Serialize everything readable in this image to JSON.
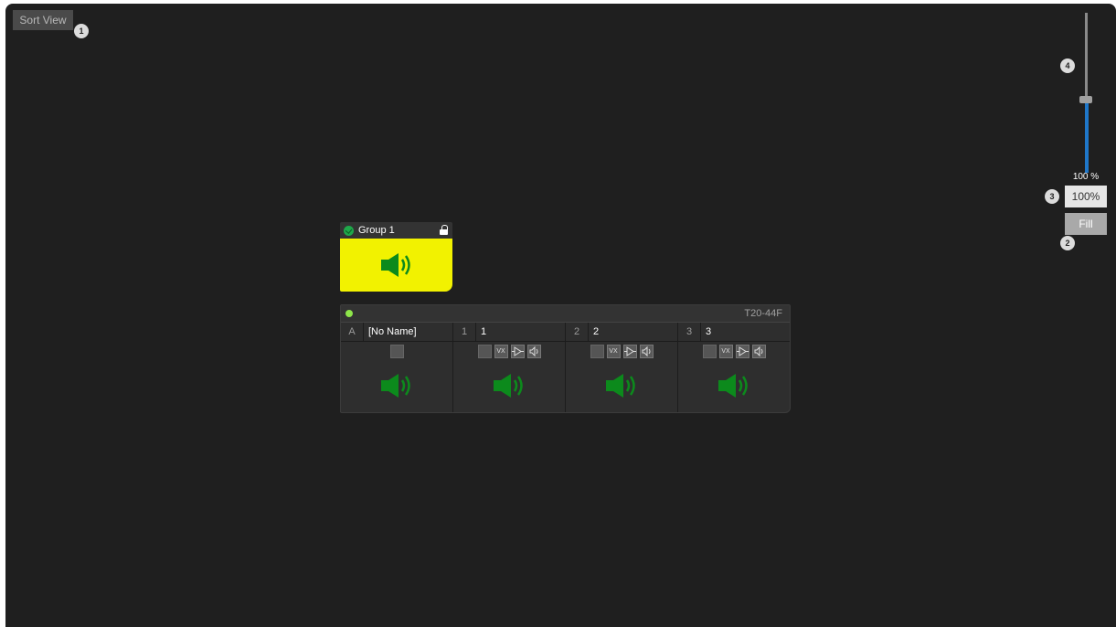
{
  "toolbar": {
    "sort_view_label": "Sort View"
  },
  "callouts": {
    "c1": "1",
    "c2": "2",
    "c3": "3",
    "c4": "4"
  },
  "zoom": {
    "level_percent": 100,
    "readout": "100 %",
    "reset_label": "100%",
    "fill_label": "Fill"
  },
  "group": {
    "name": "Group 1",
    "icon": "speaker-icon",
    "locked": true,
    "color": "#f2f200"
  },
  "device": {
    "model": "T20-44F",
    "status_color": "#8ee54a",
    "channels": [
      {
        "index": "A",
        "name": "[No Name]",
        "controls": [
          "checkbox"
        ]
      },
      {
        "index": "1",
        "name": "1",
        "controls": [
          "checkbox",
          "vx",
          "amp",
          "speaker"
        ]
      },
      {
        "index": "2",
        "name": "2",
        "controls": [
          "checkbox",
          "vx",
          "amp",
          "speaker"
        ]
      },
      {
        "index": "3",
        "name": "3",
        "controls": [
          "checkbox",
          "vx",
          "amp",
          "speaker"
        ]
      }
    ],
    "vx_label": "VX",
    "speaker_color": "#0c8a1c"
  }
}
